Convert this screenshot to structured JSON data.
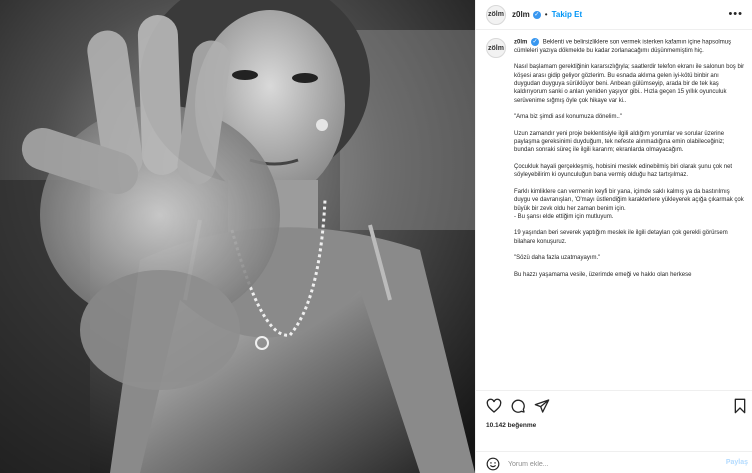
{
  "header": {
    "avatar_text": "zölm",
    "username": "z0lm",
    "follow_label": "Takip Et",
    "more_label": "•••"
  },
  "caption": {
    "username": "z0lm",
    "paragraphs": [
      "Beklenti ve belirsizliklere son vermek isterken kafamın içine hapsolmuş cümleleri yazıya dökmekte bu kadar zorlanacağımı düşünmemiştim hiç.",
      "Nasıl başlamam gerektiğinin kararsızlığıyla; saatlerdir telefon ekranı ile salonun boş bir köşesi arası gidip geliyor gözlerim. Bu esnada aklıma gelen iyi-kötü binbir anı duygudan duyguya sürüklüyor beni. Anbean gülümseyip, arada bir de tek kaş kaldırıyorum sanki o anları yeniden yaşıyor gibi.. Hızla geçen 15 yıllık oyunculuk serüvenime sığmış öyle çok hikaye var ki..",
      "\"Ama biz şimdi asıl konumuza dönelim..\"",
      "Uzun zamandır yeni proje beklentisiyle ilgili aldığım yorumlar ve sorular üzerine paylaşma gereksinimi duyduğum, tek nefeste alınmadığına emin olabileceğiniz; bundan sonraki süreç ile ilgili kararım; ekranlarda olmayacağım.",
      "Çocukluk hayali gerçekleşmiş, hobisini meslek edinebilmiş biri olarak şunu çok net söyleyebilirim ki oyunculuğun bana vermiş olduğu haz tartışılmaz.",
      "Farklı kimliklere can vermenin keyfi bir yana, içimde saklı kalmış ya da bastırılmış duygu ve davranışları, 'O'mayı üstlendiğim karakterlere yükleyerek açığa çıkarmak çok büyük bir zevk oldu her zaman benim için.",
      "- Bu şansı elde ettiğim için mutluyum.",
      "19 yaşından beri severek yaptığım meslek ile ilgili detayları çok gerekli görürsem bilahare konuşuruz.",
      "\"Sözü daha fazla uzatmayayım.\"",
      "Bu hazzı yaşamama vesile, üzerimde emeği ve hakkı olan herkese"
    ]
  },
  "actions": {
    "like_icon": "heart-icon",
    "comment_icon": "comment-icon",
    "share_icon": "share-icon",
    "save_icon": "bookmark-icon"
  },
  "likes_text": "10.142 beğenme",
  "comment_box": {
    "placeholder": "Yorum ekle...",
    "post_label": "Paylaş"
  }
}
